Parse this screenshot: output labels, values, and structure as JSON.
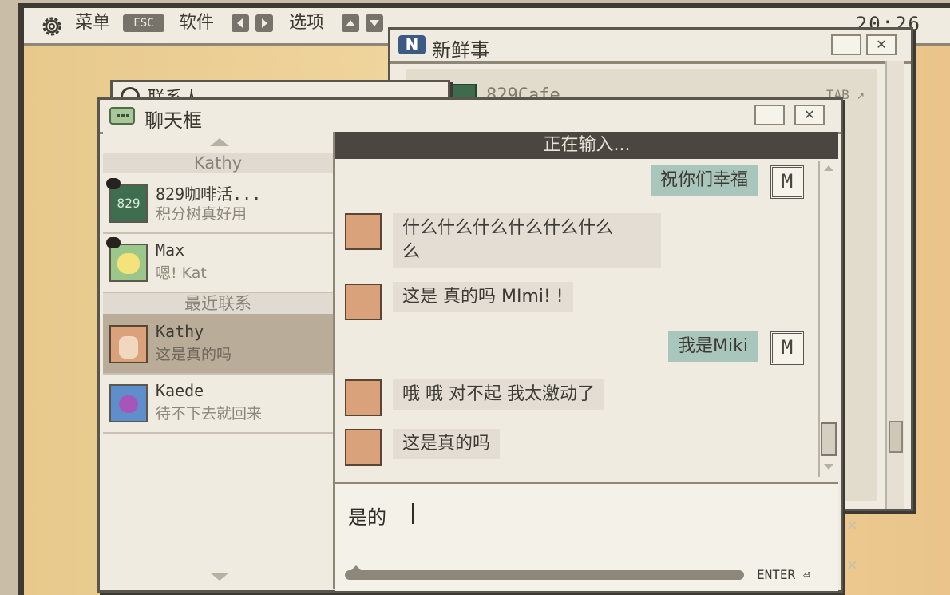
{
  "menubar": {
    "menu_label": "菜单",
    "menu_key": "ESC",
    "software_label": "软件",
    "options_label": "选项",
    "clock": "20:26"
  },
  "news_window": {
    "title": "新鲜事",
    "item_name": "829Cafe",
    "tab_label": "TAB"
  },
  "contacts_window": {
    "title": "联系人"
  },
  "chat_window": {
    "title": "聊天框",
    "typing_status": "正在输入...",
    "sections": {
      "top": "Kathy",
      "recent": "最近联系"
    },
    "contacts": [
      {
        "name": "829咖啡活...",
        "last_msg": "积分树真好用",
        "avatar_text": "829"
      },
      {
        "name": "Max",
        "last_msg": "嗯! Kat"
      },
      {
        "name": "Kathy",
        "last_msg": "这是真的吗"
      },
      {
        "name": "Kaede",
        "last_msg": "待不下去就回来"
      }
    ],
    "messages": [
      {
        "from": "me",
        "text": "祝你们幸福"
      },
      {
        "from": "Kathy",
        "text": "什么什么什么什么什么什么"
      },
      {
        "from": "Kathy",
        "text": "这是 真的吗 MImi! !"
      },
      {
        "from": "me",
        "text": "我是Miki"
      },
      {
        "from": "Kathy",
        "text": "哦 哦 对不起 我太激动了"
      },
      {
        "from": "Kathy",
        "text": "这是真的吗"
      }
    ],
    "my_avatar_letter": "M",
    "input_value": "是的",
    "enter_label": "ENTER"
  },
  "colors": {
    "accent_outgoing": "#a9c6bd",
    "incoming_bubble": "#e3ddd4",
    "selected_contact": "#b9ac98"
  }
}
